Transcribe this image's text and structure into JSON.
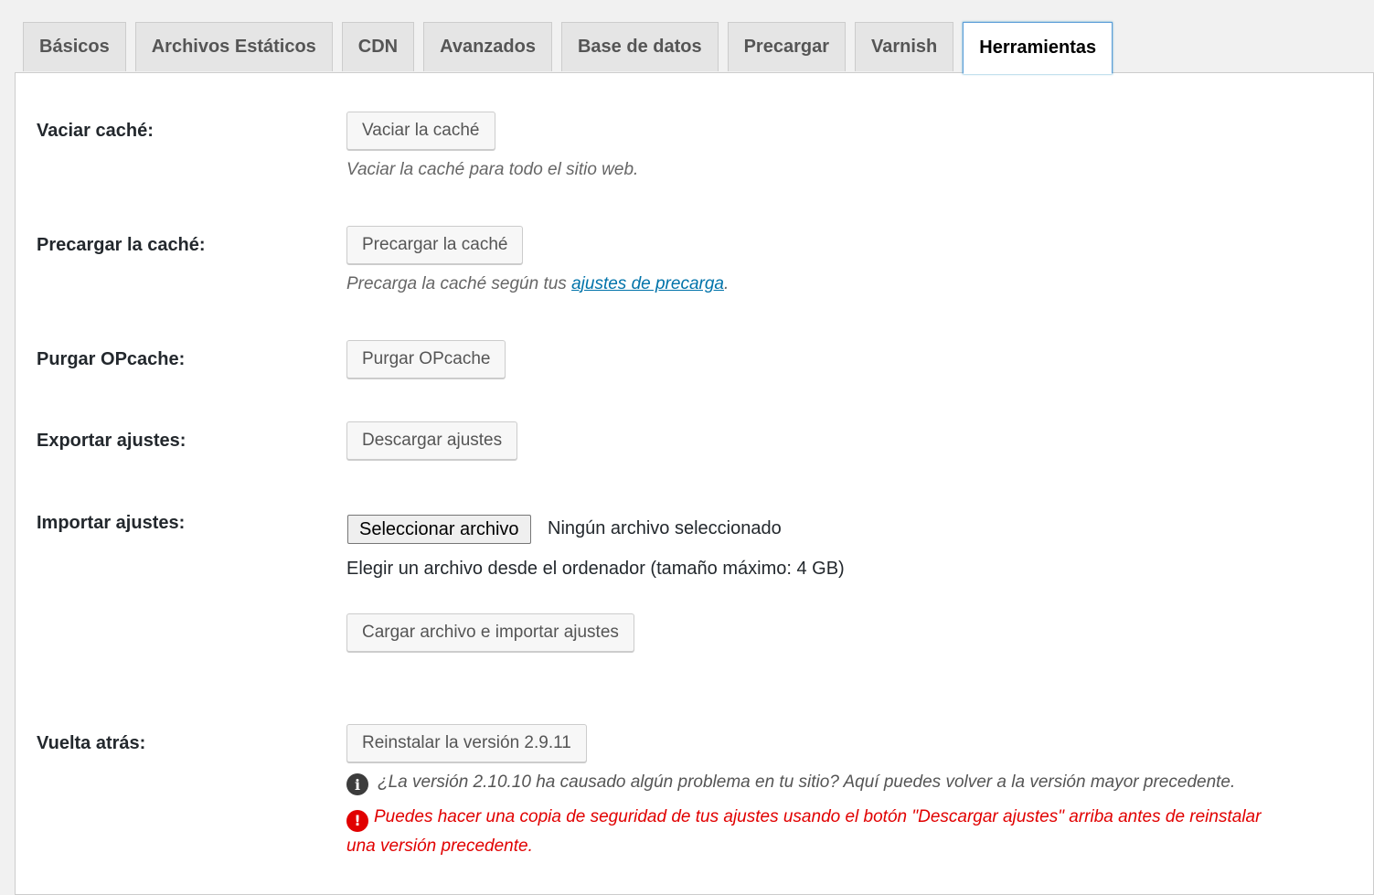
{
  "tabs": [
    {
      "label": "Básicos"
    },
    {
      "label": "Archivos Estáticos"
    },
    {
      "label": "CDN"
    },
    {
      "label": "Avanzados"
    },
    {
      "label": "Base de datos"
    },
    {
      "label": "Precargar"
    },
    {
      "label": "Varnish"
    },
    {
      "label": "Herramientas",
      "active": true
    }
  ],
  "clear_cache": {
    "label": "Vaciar caché:",
    "button": "Vaciar la caché",
    "description": "Vaciar la caché para todo el sitio web."
  },
  "preload_cache": {
    "label": "Precargar la caché:",
    "button": "Precargar la caché",
    "description_prefix": "Precarga la caché según tus ",
    "link_text": "ajustes de precarga",
    "description_suffix": "."
  },
  "purge_opcache": {
    "label": "Purgar OPcache:",
    "button": "Purgar OPcache"
  },
  "export_settings": {
    "label": "Exportar ajustes:",
    "button": "Descargar ajustes"
  },
  "import_settings": {
    "label": "Importar ajustes:",
    "file_button": "Seleccionar archivo",
    "file_status": "Ningún archivo seleccionado",
    "hint": "Elegir un archivo desde el ordenador (tamaño máximo: 4 GB)",
    "button": "Cargar archivo e importar ajustes"
  },
  "rollback": {
    "label": "Vuelta atrás:",
    "button": "Reinstalar la versión 2.9.11",
    "info_text": "¿La versión 2.10.10 ha causado algún problema en tu sitio? Aquí puedes volver a la versión mayor precedente.",
    "warning_text": "Puedes hacer una copia de seguridad de tus ajustes usando el botón \"Descargar ajustes\" arriba antes de reinstalar una versión precedente."
  },
  "icons": {
    "info": "info-icon",
    "warning": "warning-icon"
  },
  "colors": {
    "link": "#0073aa",
    "warning": "#e10000",
    "active_tab_border": "#5b9dd9"
  }
}
